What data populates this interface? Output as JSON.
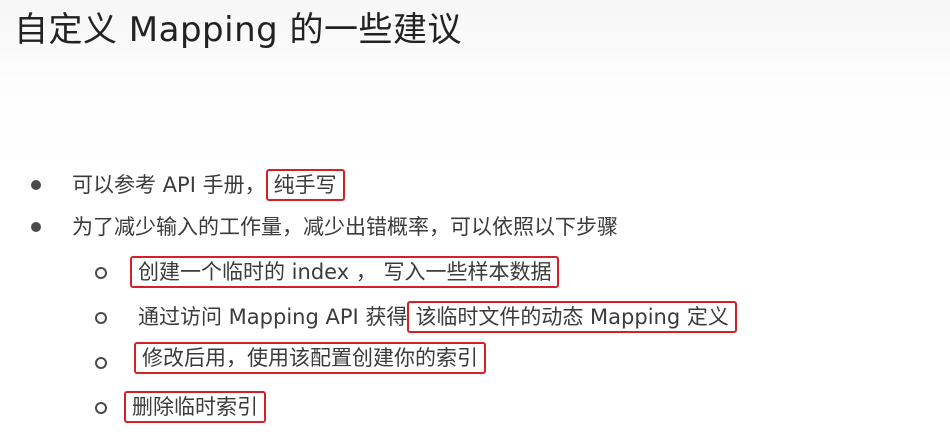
{
  "slide": {
    "title": "自定义 Mapping 的一些建议"
  },
  "bullets": [
    {
      "prefix": "可以参考 API 手册，",
      "highlight": "纯手写"
    },
    {
      "text": "为了减少输入的工作量，减少出错概率，可以依照以下步骤"
    }
  ],
  "sub_bullets": [
    {
      "prefix": "",
      "highlight": "创建一个临时的 index ， 写入一些样本数据"
    },
    {
      "prefix": "通过访问 Mapping API 获得",
      "highlight": "该临时文件的动态 Mapping 定义"
    },
    {
      "prefix": "",
      "highlight": "修改后用，使用该配置创建你的索引"
    },
    {
      "prefix": "",
      "highlight": "删除临时索引"
    }
  ],
  "colors": {
    "highlight_border": "#d61f26",
    "text": "#3b3b3b",
    "title": "#222222"
  }
}
